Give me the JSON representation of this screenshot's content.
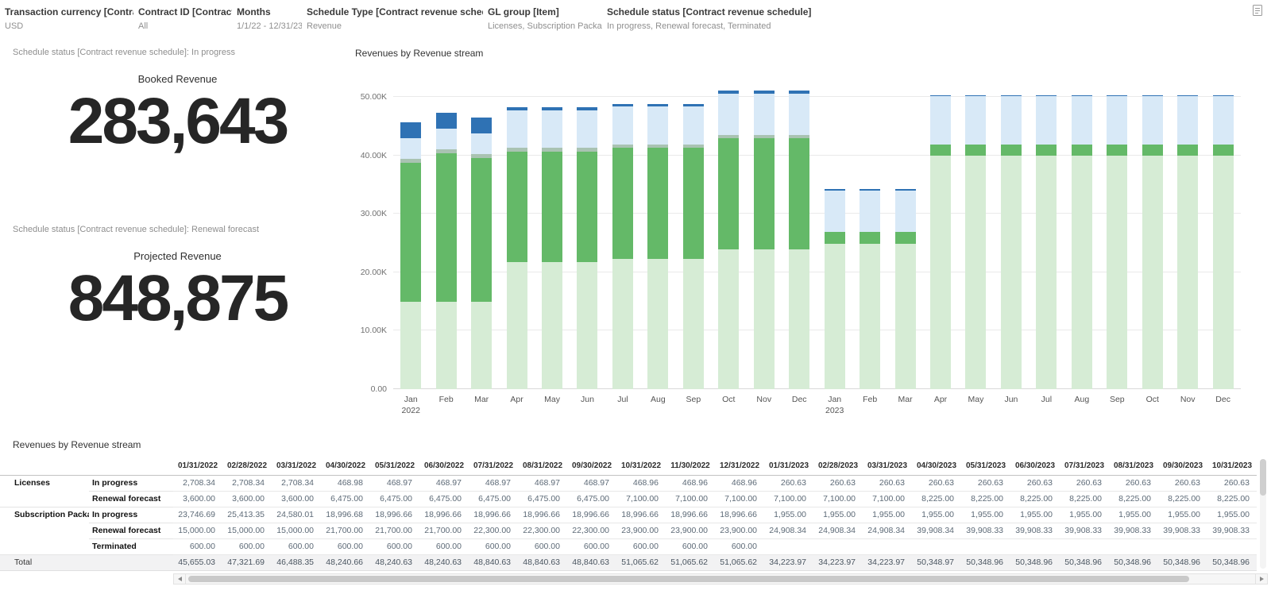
{
  "icons": {
    "top_right": "document-icon"
  },
  "filters": [
    {
      "label": "Transaction currency [Contract]",
      "value": "USD"
    },
    {
      "label": "Contract ID [Contract]",
      "value": "All"
    },
    {
      "label": "Months",
      "value": "1/1/22 - 12/31/23"
    },
    {
      "label": "Schedule Type [Contract revenue schedule]",
      "value": "Revenue"
    },
    {
      "label": "GL group [Item]",
      "value": "Licenses, Subscription Package"
    },
    {
      "label": "Schedule status [Contract revenue schedule]",
      "value": "In progress, Renewal forecast, Terminated"
    }
  ],
  "kpis": [
    {
      "note": "Schedule status [Contract revenue schedule]: In progress",
      "title": "Booked Revenue",
      "value": "283,643"
    },
    {
      "note": "Schedule status [Contract revenue schedule]: Renewal forecast",
      "title": "Projected Revenue",
      "value": "848,875"
    }
  ],
  "chart_data": {
    "type": "bar",
    "stacked": true,
    "title": "Revenues by Revenue stream",
    "grid": "horizontal",
    "ylim": [
      0,
      53000
    ],
    "y_ticks": [
      {
        "label": "0.00",
        "value": 0
      },
      {
        "label": "10.00K",
        "value": 10000
      },
      {
        "label": "20.00K",
        "value": 20000
      },
      {
        "label": "30.00K",
        "value": 30000
      },
      {
        "label": "40.00K",
        "value": 40000
      },
      {
        "label": "50.00K",
        "value": 50000
      }
    ],
    "x": [
      "Jan",
      "Feb",
      "Mar",
      "Apr",
      "May",
      "Jun",
      "Jul",
      "Aug",
      "Sep",
      "Oct",
      "Nov",
      "Dec",
      "Jan",
      "Feb",
      "Mar",
      "Apr",
      "May",
      "Jun",
      "Jul",
      "Aug",
      "Sep",
      "Oct",
      "Nov",
      "Dec"
    ],
    "x_years": {
      "0": "2022",
      "12": "2023"
    },
    "series": [
      {
        "name": "Subscription Package - Renewal forecast",
        "color": "#d6ecd5",
        "values": [
          15000,
          15000,
          15000,
          21700,
          21700,
          21700,
          22300,
          22300,
          22300,
          23900,
          23900,
          23900,
          24908.34,
          24908.34,
          24908.34,
          39908.34,
          39908.33,
          39908.33,
          39908.33,
          39908.33,
          39908.33,
          39908.33,
          39908.33,
          39908.33
        ]
      },
      {
        "name": "Subscription Package - In progress",
        "color": "#64b968",
        "values": [
          23746.69,
          25413.35,
          24580.01,
          18996.68,
          18996.66,
          18996.66,
          18996.66,
          18996.66,
          18996.66,
          18996.66,
          18996.66,
          18996.66,
          1955,
          1955,
          1955,
          1955,
          1955,
          1955,
          1955,
          1955,
          1955,
          1955,
          1955,
          1955
        ]
      },
      {
        "name": "Subscription Package - Terminated",
        "color": "#a9c3b2",
        "values": [
          600,
          600,
          600,
          600,
          600,
          600,
          600,
          600,
          600,
          600,
          600,
          600,
          0,
          0,
          0,
          0,
          0,
          0,
          0,
          0,
          0,
          0,
          0,
          0
        ]
      },
      {
        "name": "Licenses - Renewal forecast",
        "color": "#d8e9f7",
        "values": [
          3600,
          3600,
          3600,
          6475,
          6475,
          6475,
          6475,
          6475,
          6475,
          7100,
          7100,
          7100,
          7100,
          7100,
          7100,
          8225,
          8225,
          8225,
          8225,
          8225,
          8225,
          8225,
          8225,
          8225
        ]
      },
      {
        "name": "Licenses - In progress",
        "color": "#2f72b4",
        "values": [
          2708.34,
          2708.34,
          2708.34,
          468.98,
          468.97,
          468.97,
          468.97,
          468.97,
          468.97,
          468.96,
          468.96,
          468.96,
          260.63,
          260.63,
          260.63,
          260.63,
          260.63,
          260.63,
          260.63,
          260.63,
          260.63,
          260.63,
          260.63,
          260.63
        ]
      }
    ]
  },
  "table": {
    "title": "Revenues by Revenue stream",
    "columns": [
      "01/31/2022",
      "02/28/2022",
      "03/31/2022",
      "04/30/2022",
      "05/31/2022",
      "06/30/2022",
      "07/31/2022",
      "08/31/2022",
      "09/30/2022",
      "10/31/2022",
      "11/30/2022",
      "12/31/2022",
      "01/31/2023",
      "02/28/2023",
      "03/31/2023",
      "04/30/2023",
      "05/31/2023",
      "06/30/2023",
      "07/31/2023",
      "08/31/2023",
      "09/30/2023",
      "10/31/2023"
    ],
    "groups": [
      {
        "name": "Licenses",
        "rows": [
          {
            "status": "In progress",
            "values": [
              "2,708.34",
              "2,708.34",
              "2,708.34",
              "468.98",
              "468.97",
              "468.97",
              "468.97",
              "468.97",
              "468.97",
              "468.96",
              "468.96",
              "468.96",
              "260.63",
              "260.63",
              "260.63",
              "260.63",
              "260.63",
              "260.63",
              "260.63",
              "260.63",
              "260.63",
              "260.63"
            ]
          },
          {
            "status": "Renewal forecast",
            "values": [
              "3,600.00",
              "3,600.00",
              "3,600.00",
              "6,475.00",
              "6,475.00",
              "6,475.00",
              "6,475.00",
              "6,475.00",
              "6,475.00",
              "7,100.00",
              "7,100.00",
              "7,100.00",
              "7,100.00",
              "7,100.00",
              "7,100.00",
              "8,225.00",
              "8,225.00",
              "8,225.00",
              "8,225.00",
              "8,225.00",
              "8,225.00",
              "8,225.00"
            ]
          }
        ]
      },
      {
        "name": "Subscription Package",
        "rows": [
          {
            "status": "In progress",
            "values": [
              "23,746.69",
              "25,413.35",
              "24,580.01",
              "18,996.68",
              "18,996.66",
              "18,996.66",
              "18,996.66",
              "18,996.66",
              "18,996.66",
              "18,996.66",
              "18,996.66",
              "18,996.66",
              "1,955.00",
              "1,955.00",
              "1,955.00",
              "1,955.00",
              "1,955.00",
              "1,955.00",
              "1,955.00",
              "1,955.00",
              "1,955.00",
              "1,955.00"
            ]
          },
          {
            "status": "Renewal forecast",
            "values": [
              "15,000.00",
              "15,000.00",
              "15,000.00",
              "21,700.00",
              "21,700.00",
              "21,700.00",
              "22,300.00",
              "22,300.00",
              "22,300.00",
              "23,900.00",
              "23,900.00",
              "23,900.00",
              "24,908.34",
              "24,908.34",
              "24,908.34",
              "39,908.34",
              "39,908.33",
              "39,908.33",
              "39,908.33",
              "39,908.33",
              "39,908.33",
              "39,908.33"
            ]
          },
          {
            "status": "Terminated",
            "values": [
              "600.00",
              "600.00",
              "600.00",
              "600.00",
              "600.00",
              "600.00",
              "600.00",
              "600.00",
              "600.00",
              "600.00",
              "600.00",
              "600.00",
              "",
              "",
              "",
              "",
              "",
              "",
              "",
              "",
              "",
              ""
            ]
          }
        ]
      }
    ],
    "total_row": {
      "label": "Total",
      "values": [
        "45,655.03",
        "47,321.69",
        "46,488.35",
        "48,240.66",
        "48,240.63",
        "48,240.63",
        "48,840.63",
        "48,840.63",
        "48,840.63",
        "51,065.62",
        "51,065.62",
        "51,065.62",
        "34,223.97",
        "34,223.97",
        "34,223.97",
        "50,348.97",
        "50,348.96",
        "50,348.96",
        "50,348.96",
        "50,348.96",
        "50,348.96",
        "50,348.96"
      ]
    }
  }
}
